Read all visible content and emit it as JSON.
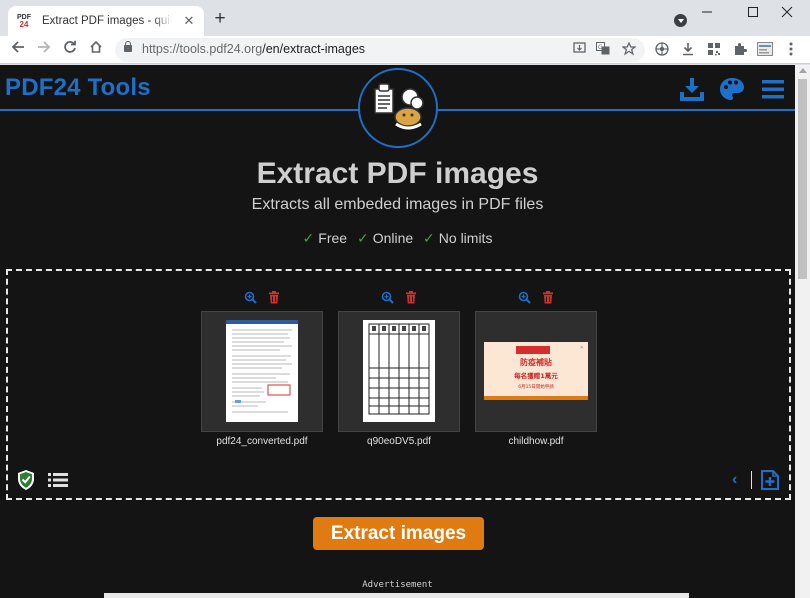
{
  "browser": {
    "tab_title": "Extract PDF images - quickly, online, free",
    "favicon_top": "PDF",
    "favicon_bottom": "24",
    "url_host": "https://tools.pdf24.org",
    "url_path": "/en/extract-images",
    "window_controls": [
      "minimize",
      "maximize",
      "close"
    ]
  },
  "site": {
    "logo": "PDF24 Tools",
    "brand_color": "#1e6fc8",
    "header_icons": [
      "download-icon",
      "palette-icon",
      "menu-icon"
    ]
  },
  "hero": {
    "title": "Extract PDF images",
    "subtitle": "Extracts all embeded images in PDF files",
    "features": [
      "Free",
      "Online",
      "No limits"
    ]
  },
  "files": [
    {
      "name": "pdf24_converted.pdf",
      "thumb": "document"
    },
    {
      "name": "q90eoDV5.pdf",
      "thumb": "grid"
    },
    {
      "name": "childhow.pdf",
      "thumb": "banner",
      "banner_lines": [
        "防疫補貼",
        "每名獲贈1萬元",
        "6月15日開始申請"
      ]
    }
  ],
  "actions": {
    "extract_label": "Extract images",
    "accent": "#e07b12"
  },
  "advertisement_label": "Advertisement"
}
